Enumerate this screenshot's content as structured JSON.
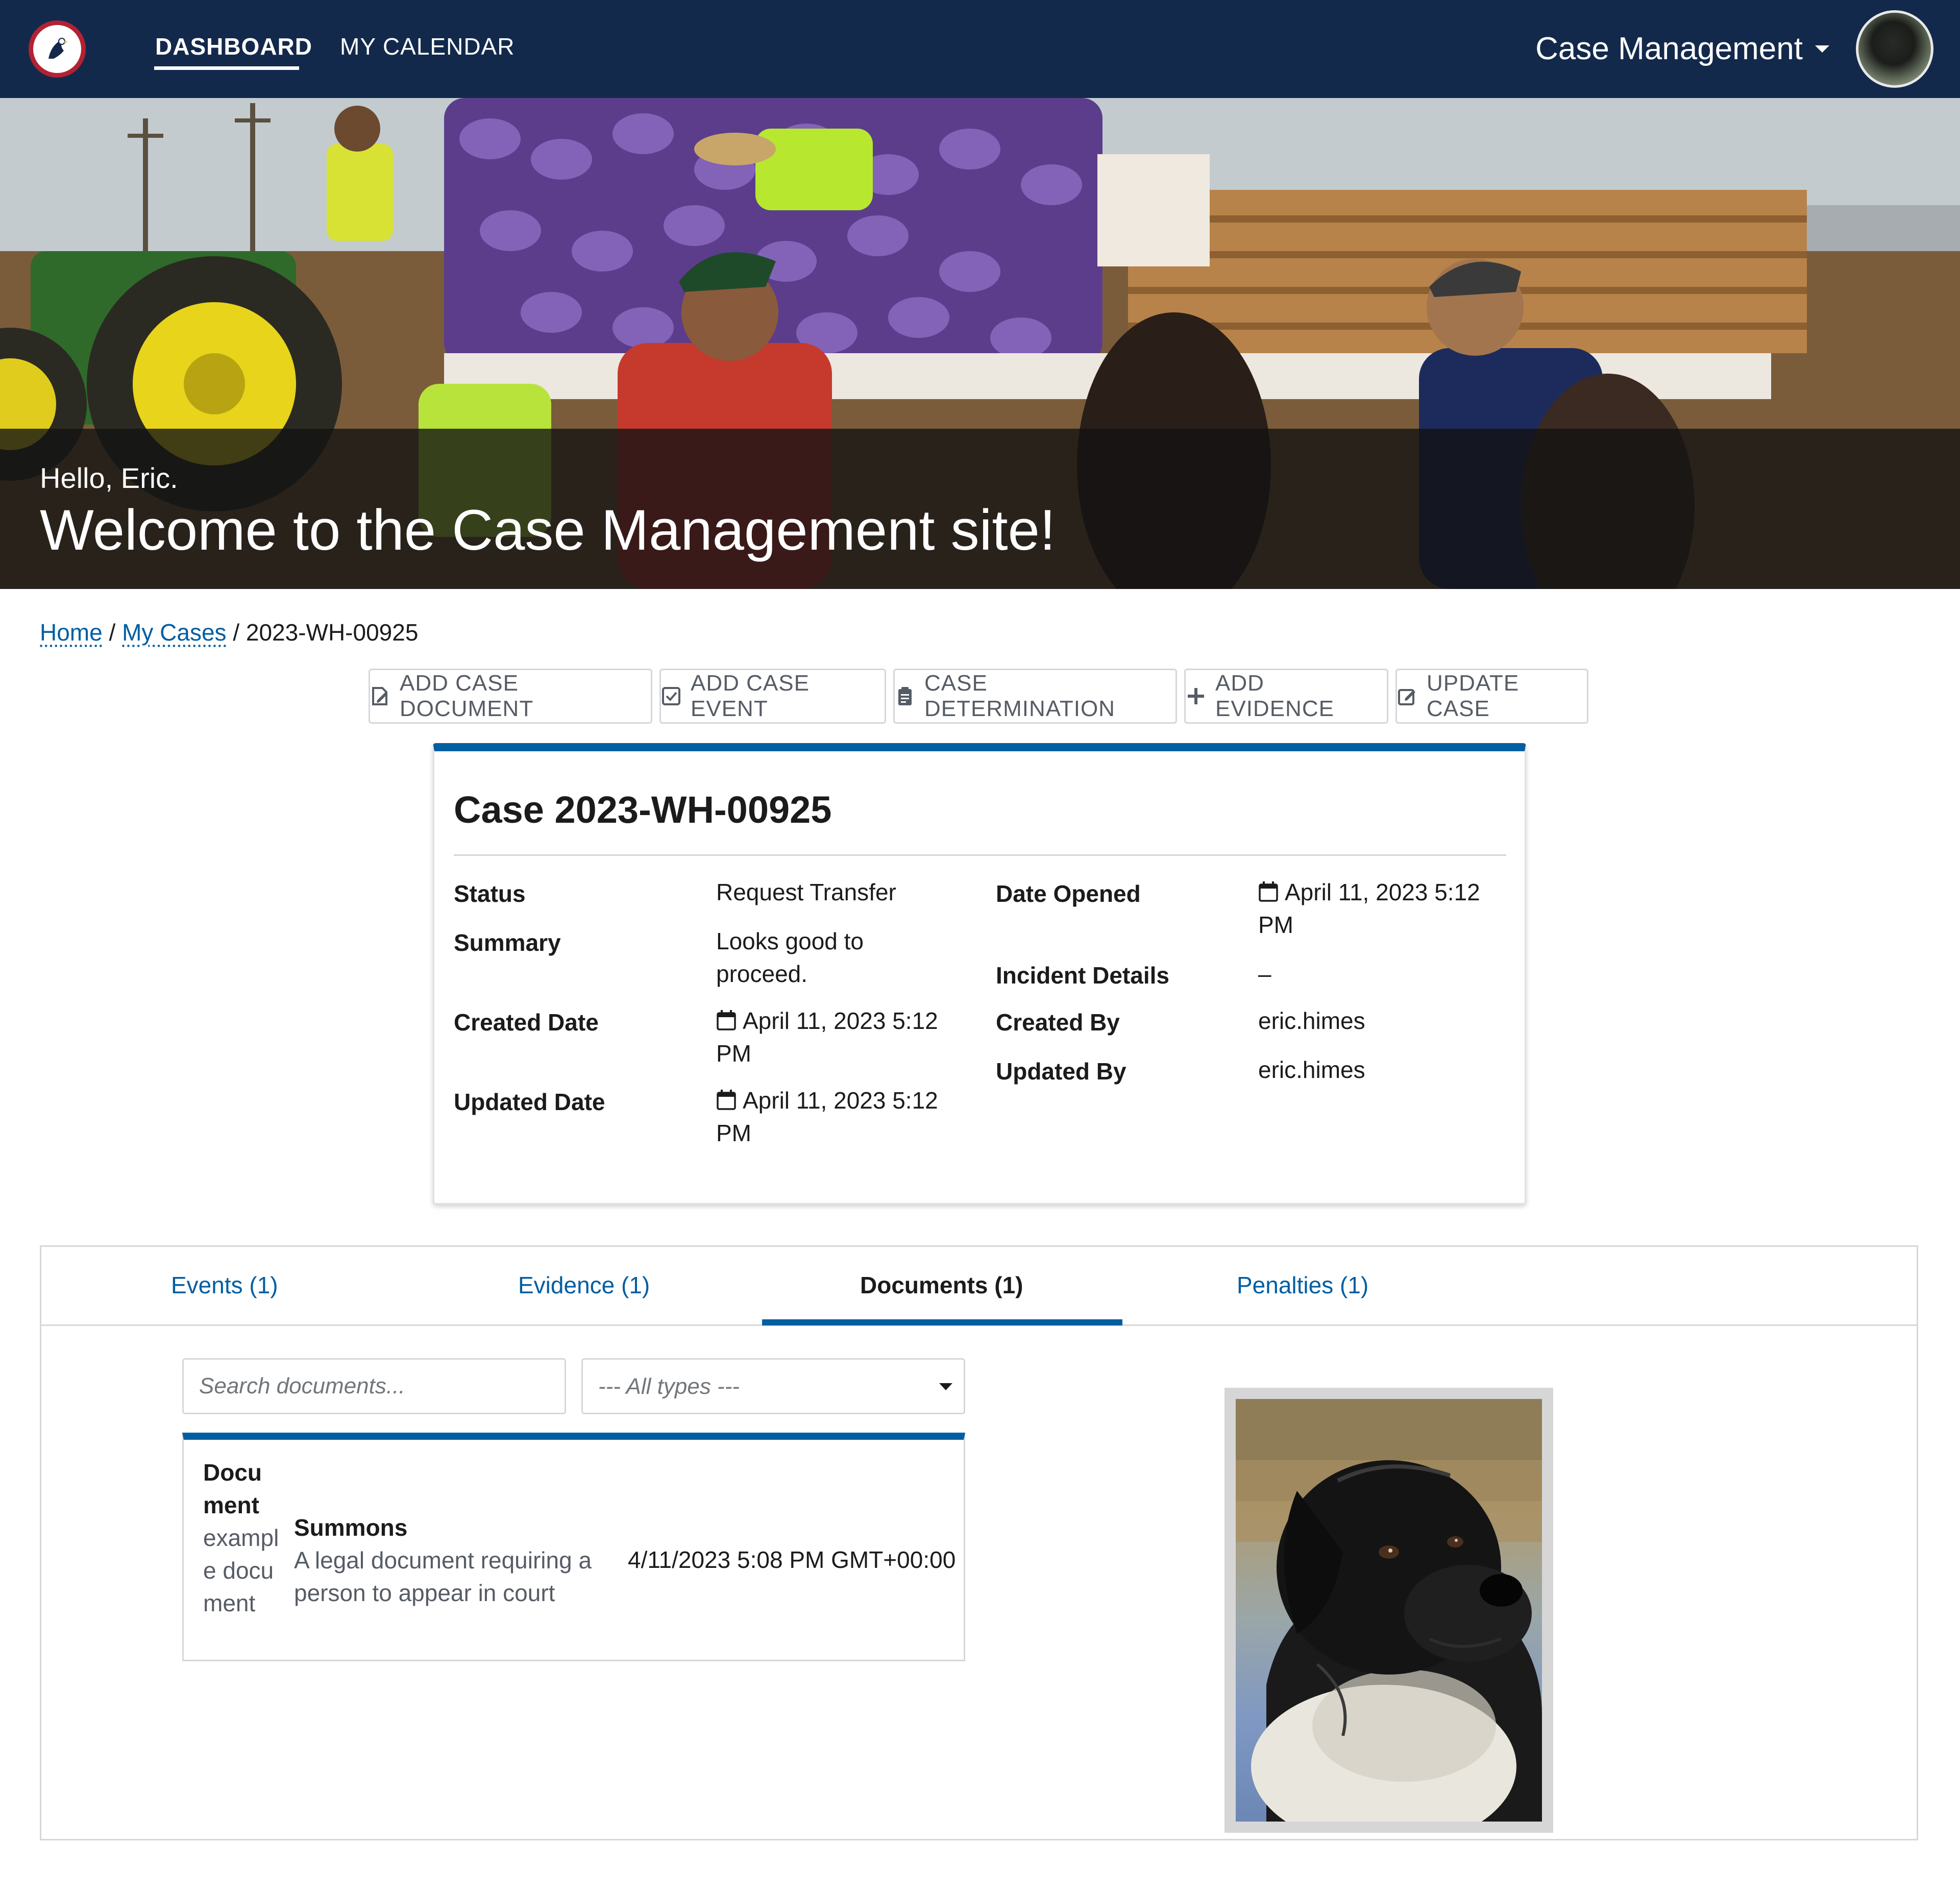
{
  "nav": {
    "links": [
      "DASHBOARD",
      "MY CALENDAR"
    ],
    "app_menu": "Case Management"
  },
  "hero": {
    "greeting": "Hello, Eric.",
    "title": "Welcome to the Case Management site!"
  },
  "breadcrumb": {
    "home": "Home",
    "separator": "/",
    "my_cases": "My Cases",
    "current": "2023-WH-00925"
  },
  "actions": [
    {
      "label": "ADD CASE DOCUMENT",
      "icon": "edit-document-icon"
    },
    {
      "label": "ADD CASE EVENT",
      "icon": "checkbox-icon"
    },
    {
      "label": "CASE DETERMINATION",
      "icon": "clipboard-icon"
    },
    {
      "label": "ADD EVIDENCE",
      "icon": "plus-icon"
    },
    {
      "label": "UPDATE CASE",
      "icon": "edit-icon"
    }
  ],
  "case": {
    "title": "Case 2023-WH-00925",
    "status_label": "Status",
    "status": "Request Transfer",
    "summary_label": "Summary",
    "summary": "Looks good to proceed.",
    "created_date_label": "Created Date",
    "created_date": "April 11, 2023 5:12 PM",
    "updated_date_label": "Updated Date",
    "updated_date": "April 11, 2023 5:12 PM",
    "date_opened_label": "Date Opened",
    "date_opened": "April 11, 2023 5:12 PM",
    "incident_details_label": "Incident Details",
    "incident_details": "–",
    "created_by_label": "Created By",
    "created_by": "eric.himes",
    "updated_by_label": "Updated By",
    "updated_by": "eric.himes"
  },
  "tabs": [
    {
      "label": "Events (1)",
      "active": false
    },
    {
      "label": "Evidence (1)",
      "active": false
    },
    {
      "label": "Documents (1)",
      "active": true
    },
    {
      "label": "Penalties (1)",
      "active": false
    }
  ],
  "documents": {
    "search_placeholder": "Search documents...",
    "type_filter_selected": "--- All types ---",
    "rows": [
      {
        "name": "Document",
        "description": "example document",
        "type_name": "Summons",
        "type_description": "A legal document requiring a person to appear in court",
        "timestamp": "4/11/2023 5:08 PM GMT+00:00"
      }
    ]
  },
  "colors": {
    "nav_bg": "#13294b",
    "accent": "#005ea2",
    "text": "#1b1b1b",
    "muted": "#565c65",
    "border": "#d6d7d9"
  }
}
